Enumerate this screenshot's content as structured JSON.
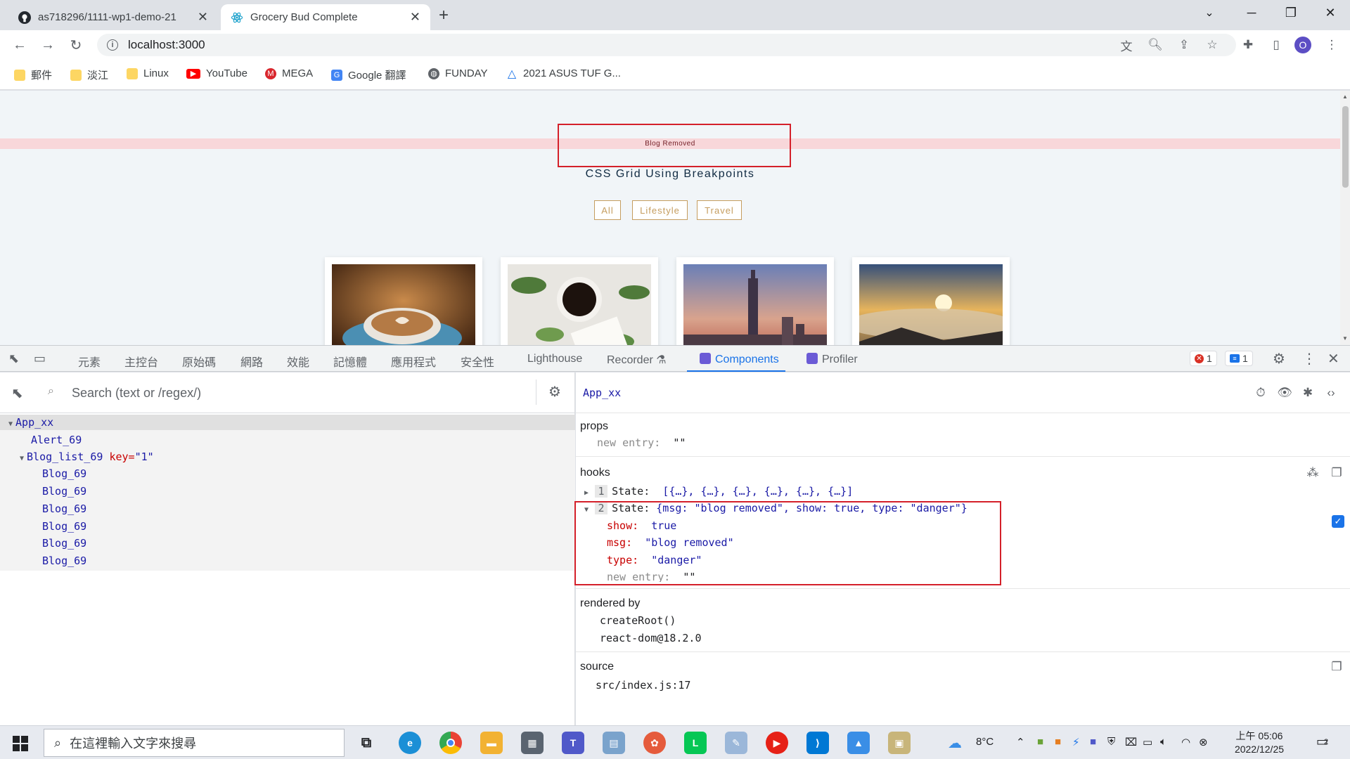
{
  "tabs": [
    {
      "title": "as718296/1111-wp1-demo-21",
      "active": false
    },
    {
      "title": "Grocery Bud Complete",
      "active": true
    }
  ],
  "window_controls": {
    "minimize": "─",
    "restore": "❐",
    "close": "✕",
    "dropdown": "⌄"
  },
  "toolbar": {
    "url": "localhost:3000",
    "profile_initial": "O",
    "new_tab": "+"
  },
  "bookmarks": [
    {
      "label": "郵件",
      "icon": "folder-icon"
    },
    {
      "label": "淡江",
      "icon": "folder-icon"
    },
    {
      "label": "Linux",
      "icon": "folder-icon"
    },
    {
      "label": "YouTube",
      "icon": "youtube-icon"
    },
    {
      "label": "MEGA",
      "icon": "mega-icon"
    },
    {
      "label": "Google 翻譯",
      "icon": "translate-icon"
    },
    {
      "label": "FUNDAY",
      "icon": "globe-icon"
    },
    {
      "label": "2021 ASUS TUF G...",
      "icon": "asus-icon"
    }
  ],
  "page": {
    "alert_text": "Blog Removed",
    "title": "CSS Grid Using Breakpoints",
    "filters": [
      "All",
      "Lifestyle",
      "Travel"
    ]
  },
  "devtools": {
    "tabs": [
      "元素",
      "主控台",
      "原始碼",
      "網路",
      "效能",
      "記憶體",
      "應用程式",
      "安全性",
      "Lighthouse",
      "Recorder",
      "Components",
      "Profiler"
    ],
    "active_tab": "Components",
    "errors": "1",
    "messages": "1",
    "search_placeholder": "Search (text or /regex/)",
    "tree": [
      {
        "name": "App_xx",
        "depth": 0,
        "arrow": "▼"
      },
      {
        "name": "Alert_69",
        "depth": 1,
        "arrow": ""
      },
      {
        "name": "Blog_list_69",
        "depth": 1,
        "arrow": "▼",
        "key_label": "key=",
        "key_value": "\"1\""
      },
      {
        "name": "Blog_69",
        "depth": 2,
        "arrow": ""
      },
      {
        "name": "Blog_69",
        "depth": 2,
        "arrow": ""
      },
      {
        "name": "Blog_69",
        "depth": 2,
        "arrow": ""
      },
      {
        "name": "Blog_69",
        "depth": 2,
        "arrow": ""
      },
      {
        "name": "Blog_69",
        "depth": 2,
        "arrow": ""
      },
      {
        "name": "Blog_69",
        "depth": 2,
        "arrow": ""
      }
    ],
    "selected_component": "App_xx",
    "props": {
      "header": "props",
      "new_entry_key": "new entry:",
      "new_entry_value": "\"\""
    },
    "hooks": {
      "header": "hooks",
      "state1_index": "1",
      "state1_label": "State:",
      "state1_value": "[{…}, {…}, {…}, {…}, {…}, {…}]",
      "state2_index": "2",
      "state2_label": "State:",
      "state2_value": "{msg: \"blog removed\", show: true, type: \"danger\"}",
      "show_key": "show:",
      "show_value": "true",
      "msg_key": "msg:",
      "msg_value": "\"blog removed\"",
      "type_key": "type:",
      "type_value": "\"danger\"",
      "new_entry_key": "new entry:",
      "new_entry_value": "\"\""
    },
    "rendered_by": {
      "header": "rendered by",
      "items": [
        "createRoot()",
        "react-dom@18.2.0"
      ]
    },
    "source": {
      "header": "source",
      "file": "src/index.js:17"
    }
  },
  "taskbar": {
    "search_placeholder": "在這裡輸入文字來搜尋",
    "weather": "8°C",
    "time": "上午 05:06",
    "date": "2022/12/25",
    "notification_count": "2"
  },
  "colors": {
    "accent": "#1a73e8",
    "alert_bg": "#f8d7da",
    "highlight_box": "#d4202a",
    "filter_gold": "#c59d5f"
  }
}
